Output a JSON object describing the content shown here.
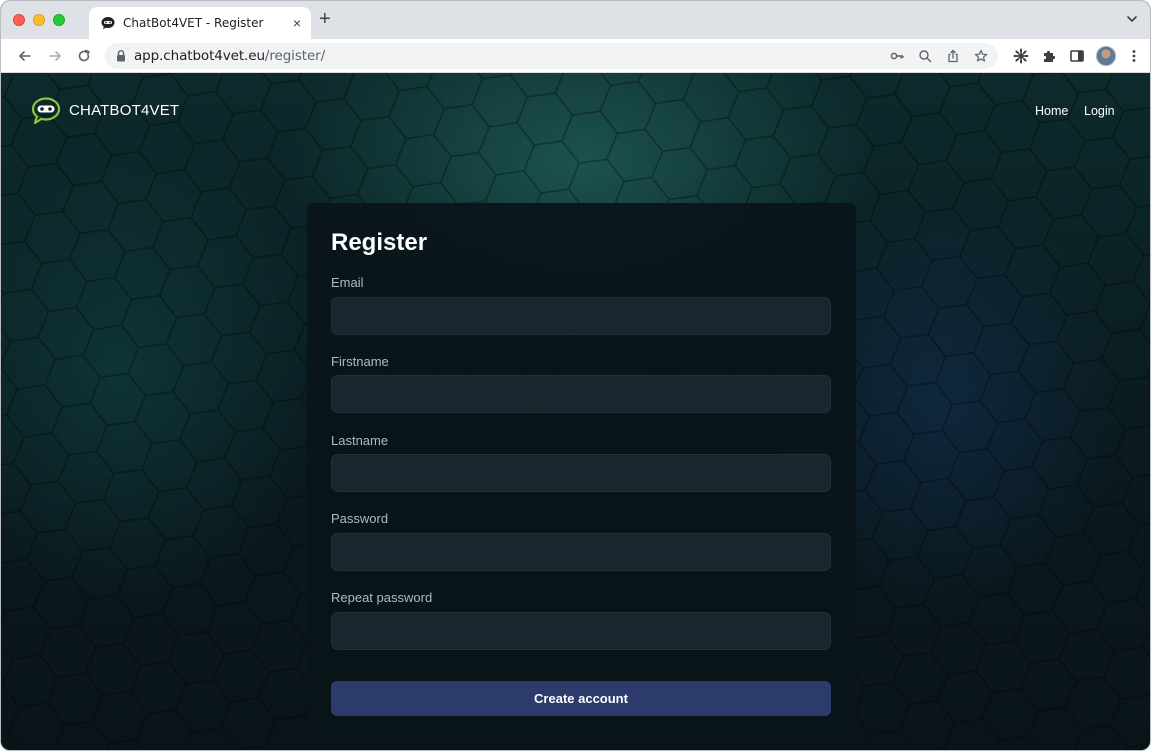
{
  "browser": {
    "tab_title": "ChatBot4VET - Register",
    "tab_close": "×",
    "new_tab": "+",
    "url_domain": "app.chatbot4vet.eu",
    "url_path": "/register/",
    "icons": [
      "back-arrow-icon",
      "forward-arrow-icon",
      "reload-icon",
      "lock-icon",
      "key-icon",
      "zoom-icon",
      "share-icon",
      "star-icon",
      "extension-icon",
      "puzzle-icon",
      "sidepanel-icon",
      "profile-avatar",
      "kebab-menu-icon",
      "tab-list-chevron-icon"
    ]
  },
  "site": {
    "brand_name": "CHATBOT4VET",
    "nav": {
      "home": "Home",
      "login": "Login"
    },
    "accent_color": "#2c3b6c",
    "logo_color": "#8cc63f"
  },
  "form": {
    "title": "Register",
    "fields": [
      {
        "label": "Email",
        "value": ""
      },
      {
        "label": "Firstname",
        "value": ""
      },
      {
        "label": "Lastname",
        "value": ""
      },
      {
        "label": "Password",
        "value": ""
      },
      {
        "label": "Repeat password",
        "value": ""
      }
    ],
    "submit_label": "Create account"
  }
}
